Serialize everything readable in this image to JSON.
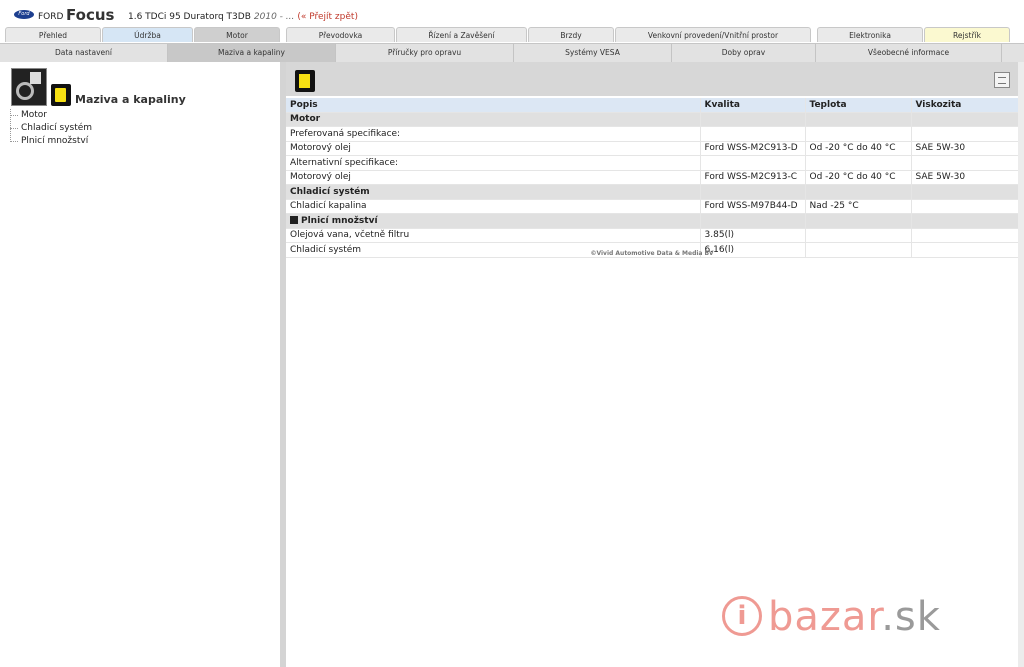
{
  "header": {
    "brand_logo": "Ford",
    "brand": "FORD",
    "model": "Focus",
    "variant": "1.6 TDCi 95 Duratorq T3DB",
    "year": "2010 - ...",
    "back_link": "(« Přejít zpět)"
  },
  "main_tabs": [
    {
      "label": "Přehled",
      "state": "normal"
    },
    {
      "label": "Údržba",
      "state": "blue"
    },
    {
      "label": "Motor",
      "state": "active"
    },
    {
      "label": "Převodovka",
      "state": "normal"
    },
    {
      "label": "Řízení a Zavěšení",
      "state": "normal"
    },
    {
      "label": "Brzdy",
      "state": "normal"
    },
    {
      "label": "Venkovní provedení/Vnitřní prostor",
      "state": "normal"
    },
    {
      "label": "Elektronika",
      "state": "normal"
    },
    {
      "label": "Rejstřík",
      "state": "yellow"
    }
  ],
  "sub_tabs": [
    {
      "label": "Data nastavení",
      "state": "normal"
    },
    {
      "label": "Maziva a kapaliny",
      "state": "active"
    },
    {
      "label": "Příručky pro opravu",
      "state": "normal"
    },
    {
      "label": "Systémy VESA",
      "state": "normal"
    },
    {
      "label": "Doby oprav",
      "state": "normal"
    },
    {
      "label": "Všeobecné informace",
      "state": "normal"
    }
  ],
  "sidebar": {
    "title": "Maziva a kapaliny",
    "items": [
      {
        "label": "Motor"
      },
      {
        "label": "Chladicí systém"
      },
      {
        "label": "Plnicí množství"
      }
    ]
  },
  "table": {
    "headers": {
      "popis": "Popis",
      "kvalita": "Kvalita",
      "teplota": "Teplota",
      "viskozita": "Viskozita"
    },
    "rows": [
      {
        "type": "section",
        "popis": "Motor",
        "kvalita": "",
        "teplota": "",
        "viskozita": ""
      },
      {
        "type": "row",
        "popis": "Preferovaná specifikace:",
        "kvalita": "",
        "teplota": "",
        "viskozita": ""
      },
      {
        "type": "row",
        "popis": "Motorový olej",
        "kvalita": "Ford WSS-M2C913-D",
        "teplota": "Od -20 °C do 40 °C",
        "viskozita": "SAE 5W-30"
      },
      {
        "type": "row",
        "popis": "Alternativní specifikace:",
        "kvalita": "",
        "teplota": "",
        "viskozita": ""
      },
      {
        "type": "row",
        "popis": "Motorový olej",
        "kvalita": "Ford WSS-M2C913-C",
        "teplota": "Od -20 °C do 40 °C",
        "viskozita": "SAE 5W-30"
      },
      {
        "type": "section",
        "popis": "Chladicí systém",
        "kvalita": "",
        "teplota": "",
        "viskozita": ""
      },
      {
        "type": "row",
        "popis": "Chladicí kapalina",
        "kvalita": "Ford WSS-M97B44-D",
        "teplota": "Nad -25 °C",
        "viskozita": ""
      },
      {
        "type": "section-icon",
        "popis": "Plnicí množství",
        "kvalita": "",
        "teplota": "",
        "viskozita": ""
      },
      {
        "type": "row",
        "popis": "Olejová vana, včetně filtru",
        "kvalita": "3.85(l)",
        "teplota": "",
        "viskozita": ""
      },
      {
        "type": "row",
        "popis": "Chladicí systém",
        "kvalita": "6.16(l)",
        "teplota": "",
        "viskozita": ""
      }
    ]
  },
  "copyright": "©Vivid Automotive Data & Media BV",
  "watermark": {
    "icon": "i",
    "name": "bazar",
    "ext": ".sk"
  },
  "colors": {
    "header_row": "#dce7f4",
    "section_row": "#e0e0e0",
    "oil_can": "#f6e013",
    "watermark": "#ef9a93"
  }
}
